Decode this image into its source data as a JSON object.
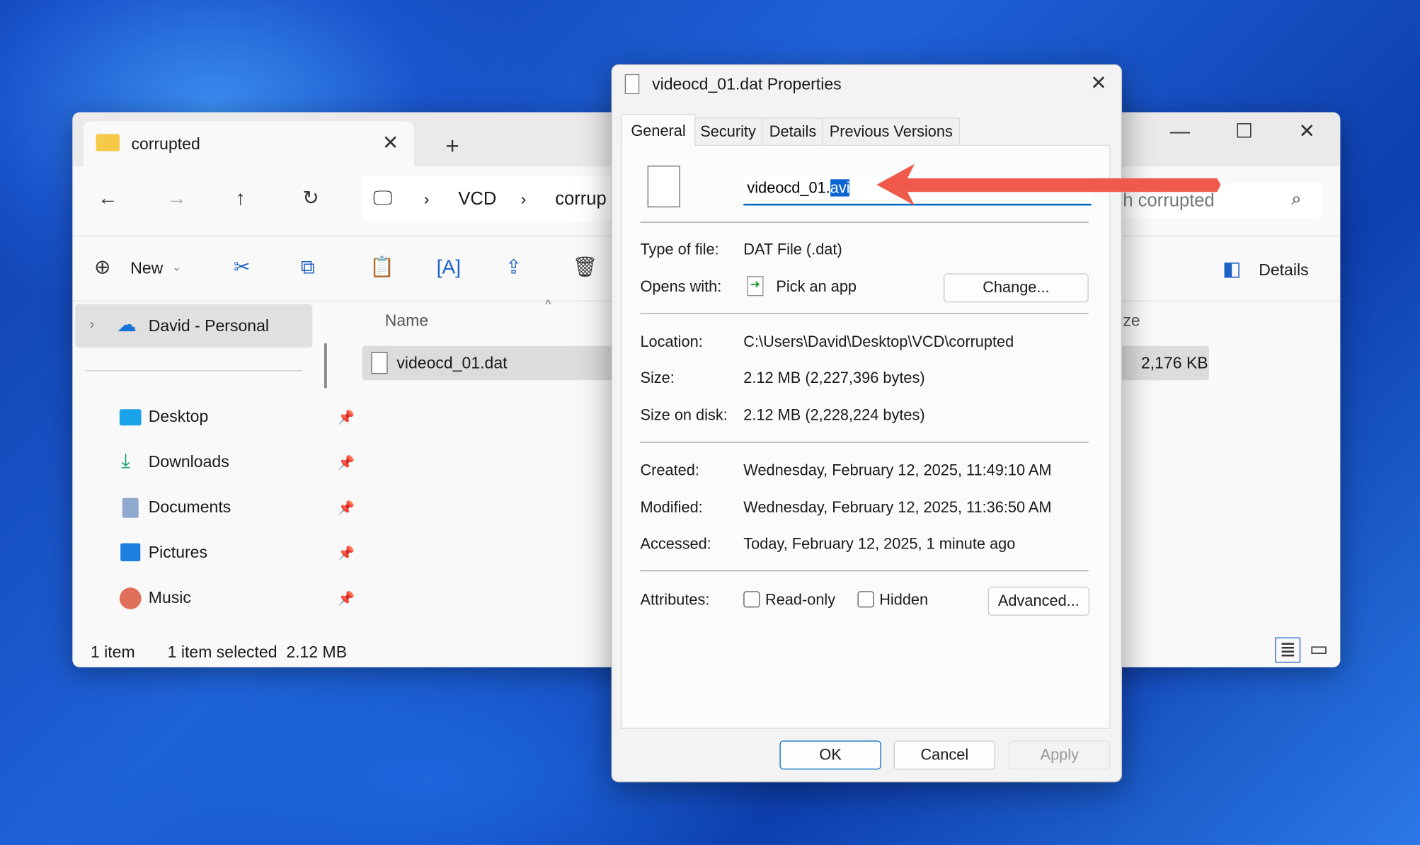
{
  "explorer": {
    "tab_title": "corrupted",
    "breadcrumb": [
      "VCD",
      "corrup"
    ],
    "search_placeholder": "h corrupted",
    "toolbar": {
      "new_label": "New",
      "details_label": "Details"
    },
    "sidebar": {
      "onedrive": "David - Personal",
      "items": [
        {
          "label": "Desktop",
          "icon": "desktop-icon"
        },
        {
          "label": "Downloads",
          "icon": "download-icon"
        },
        {
          "label": "Documents",
          "icon": "documents-icon"
        },
        {
          "label": "Pictures",
          "icon": "pictures-icon"
        },
        {
          "label": "Music",
          "icon": "music-icon"
        }
      ]
    },
    "columns": {
      "name": "Name",
      "size": "ze"
    },
    "file": {
      "name": "videocd_01.dat",
      "size": "2,176 KB"
    },
    "status": {
      "count": "1 item",
      "selected": "1 item selected  2.12 MB"
    }
  },
  "dialog": {
    "title": "videocd_01.dat Properties",
    "tabs": [
      "General",
      "Security",
      "Details",
      "Previous Versions"
    ],
    "filename_base": "videocd_01.",
    "filename_selected": "avi",
    "type_label": "Type of file:",
    "type_value": "DAT File (.dat)",
    "opens_label": "Opens with:",
    "opens_value": "Pick an app",
    "change_button": "Change...",
    "location_label": "Location:",
    "location_value": "C:\\Users\\David\\Desktop\\VCD\\corrupted",
    "size_label": "Size:",
    "size_value": "2.12 MB (2,227,396 bytes)",
    "disk_label": "Size on disk:",
    "disk_value": "2.12 MB (2,228,224 bytes)",
    "created_label": "Created:",
    "created_value": "Wednesday, February 12, 2025, 11:49:10 AM",
    "modified_label": "Modified:",
    "modified_value": "Wednesday, February 12, 2025, 11:36:50 AM",
    "accessed_label": "Accessed:",
    "accessed_value": "Today, February 12, 2025, 1 minute ago",
    "attributes_label": "Attributes:",
    "readonly_label": "Read-only",
    "hidden_label": "Hidden",
    "advanced_button": "Advanced...",
    "ok_button": "OK",
    "cancel_button": "Cancel",
    "apply_button": "Apply"
  },
  "colors": {
    "annotation_arrow": "#ef5a4c",
    "selection": "#0a64d2",
    "accent": "#0067c0"
  }
}
